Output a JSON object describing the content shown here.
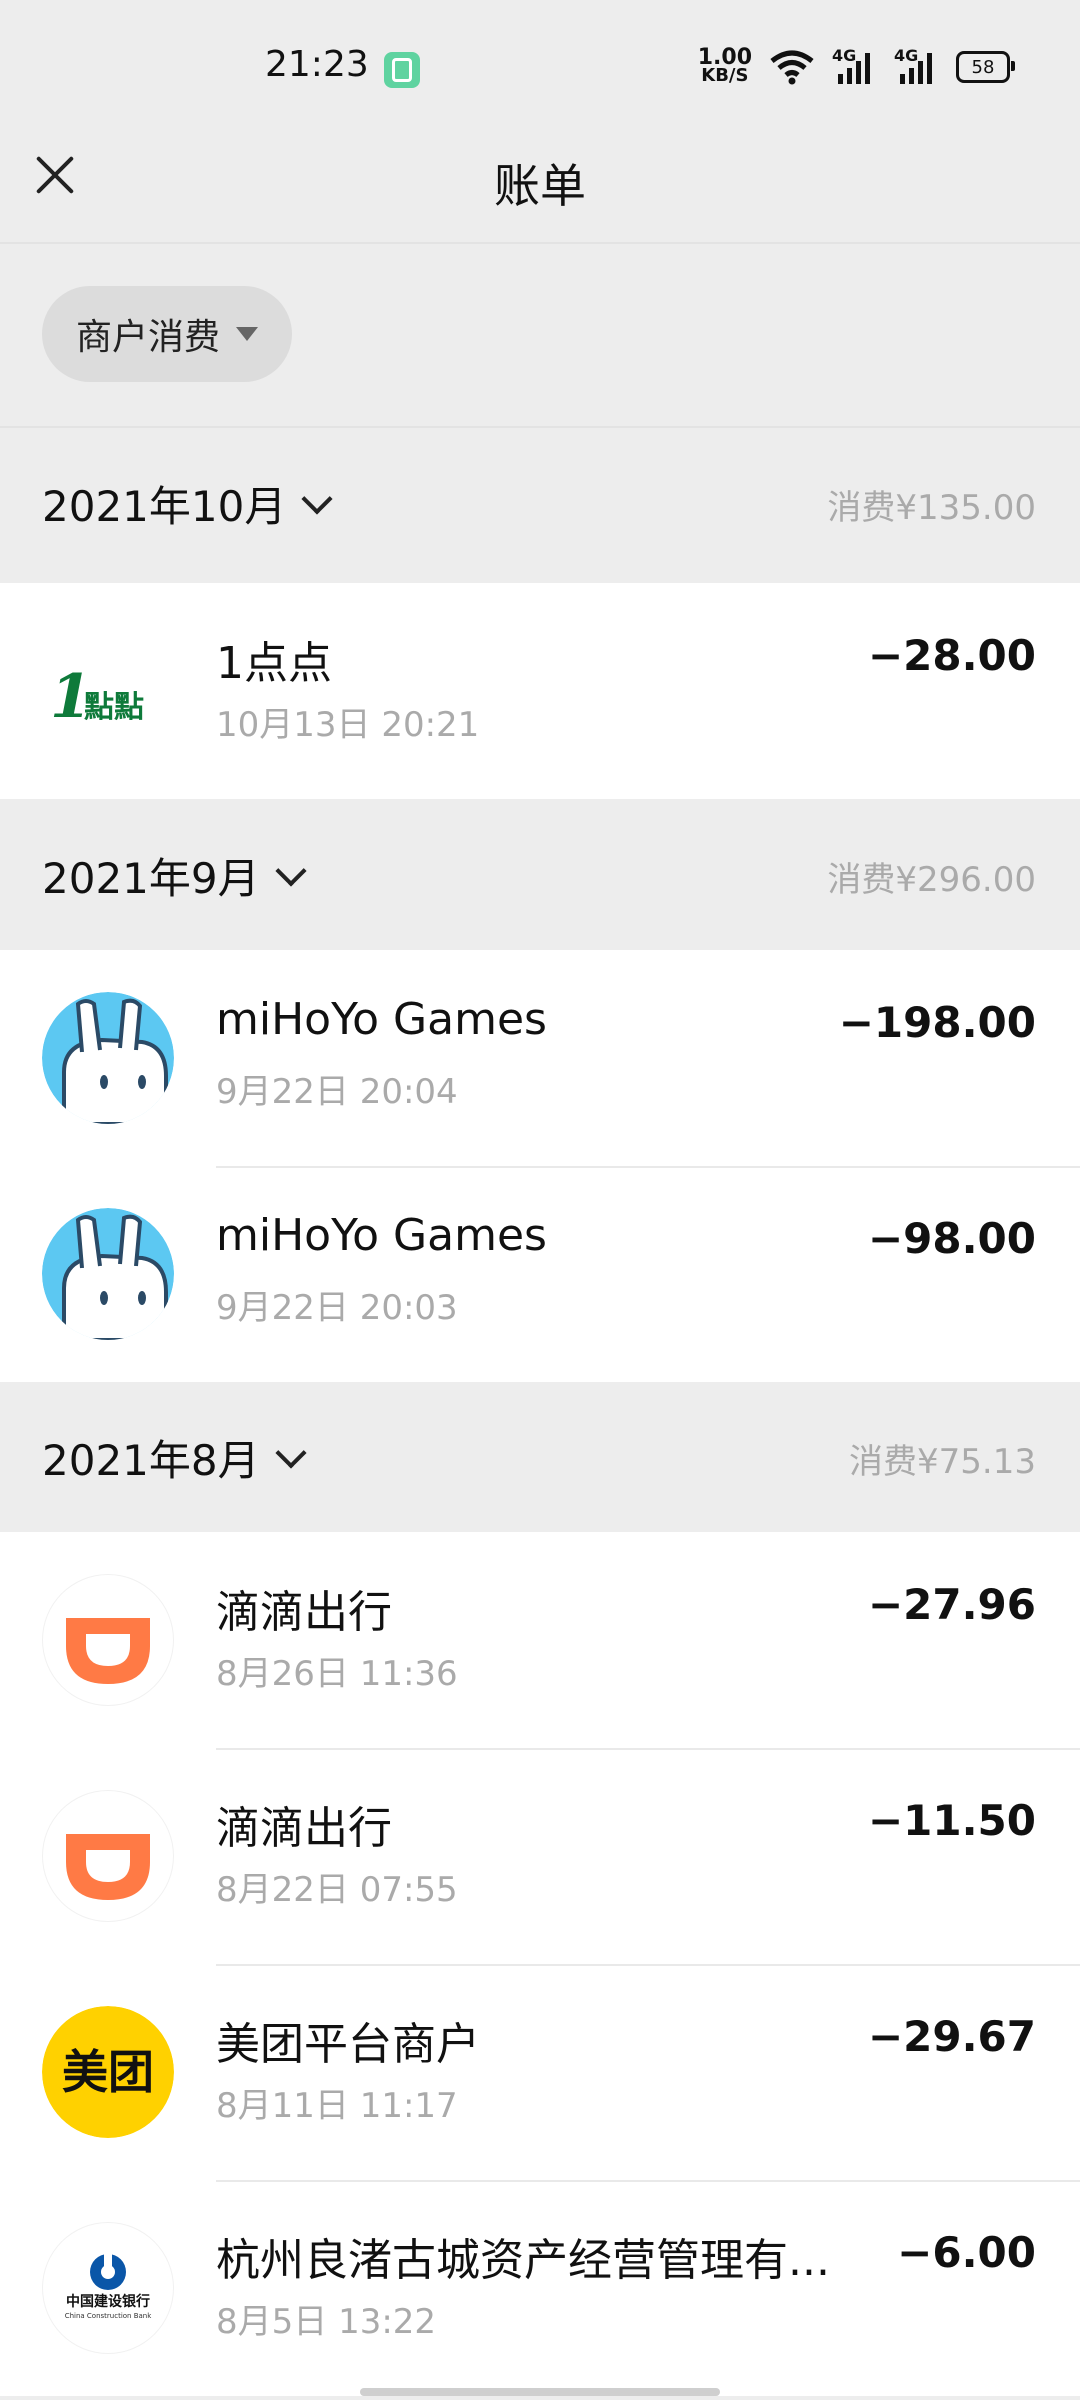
{
  "status": {
    "time": "21:23",
    "speed_value": "1.00",
    "speed_unit": "KB/S",
    "sig1_label": "4G",
    "sig2_label": "4G",
    "battery": "58"
  },
  "header": {
    "title": "账单"
  },
  "filter": {
    "label": "商户消费"
  },
  "months": [
    {
      "title": "2021年10月",
      "total": "消费¥135.00"
    },
    {
      "title": "2021年9月",
      "total": "消费¥296.00"
    },
    {
      "title": "2021年8月",
      "total": "消费¥75.13"
    }
  ],
  "transactions": [
    {
      "name": "1点点",
      "time": "10月13日 20:21",
      "amount": "−28.00",
      "icon": "yidiandian-logo"
    },
    {
      "name": "miHoYo Games",
      "time": "9月22日 20:04",
      "amount": "−198.00",
      "icon": "mihoyo-logo"
    },
    {
      "name": "miHoYo Games",
      "time": "9月22日 20:03",
      "amount": "−98.00",
      "icon": "mihoyo-logo"
    },
    {
      "name": "滴滴出行",
      "time": "8月26日 11:36",
      "amount": "−27.96",
      "icon": "didi-logo"
    },
    {
      "name": "滴滴出行",
      "time": "8月22日 07:55",
      "amount": "−11.50",
      "icon": "didi-logo"
    },
    {
      "name": "美团平台商户",
      "time": "8月11日 11:17",
      "amount": "−29.67",
      "icon": "meituan-logo"
    },
    {
      "name": "杭州良渚古城资产经营管理有...",
      "time": "8月5日 13:22",
      "amount": "−6.00",
      "icon": "ccb-logo"
    }
  ],
  "logos": {
    "yidiandian_num": "1",
    "yidiandian_text": "點點",
    "meituan_text": "美团",
    "ccb_cn": "中国建设银行",
    "ccb_en": "China Construction Bank"
  },
  "colors": {
    "background": "#ededed",
    "amount": "#111111",
    "meta": "#aaaaaa",
    "mihoyo": "#5cc8f2",
    "didi": "#ff7a45",
    "meituan": "#ffd100",
    "ccb": "#0a56a8",
    "yidiandian": "#0e7a3a"
  }
}
